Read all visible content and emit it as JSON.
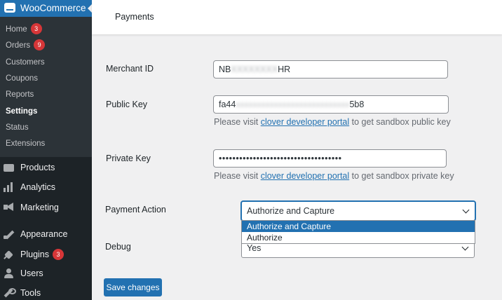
{
  "sidebar": {
    "brand": "WooCommerce",
    "submenu": [
      {
        "label": "Home",
        "badge": "3"
      },
      {
        "label": "Orders",
        "badge": "9"
      },
      {
        "label": "Customers"
      },
      {
        "label": "Coupons"
      },
      {
        "label": "Reports"
      },
      {
        "label": "Settings",
        "active": true
      },
      {
        "label": "Status"
      },
      {
        "label": "Extensions"
      }
    ],
    "menu": [
      {
        "label": "Products",
        "icon": "products-icon"
      },
      {
        "label": "Analytics",
        "icon": "analytics-icon"
      },
      {
        "label": "Marketing",
        "icon": "marketing-icon"
      },
      {
        "label": "Appearance",
        "icon": "appearance-icon"
      },
      {
        "label": "Plugins",
        "icon": "plugins-icon",
        "badge": "3"
      },
      {
        "label": "Users",
        "icon": "users-icon"
      },
      {
        "label": "Tools",
        "icon": "tools-icon"
      }
    ]
  },
  "header": {
    "title": "Payments"
  },
  "form": {
    "merchant_id": {
      "label": "Merchant ID",
      "value_prefix": "NB",
      "value_masked": "XXXXXXXX",
      "value_suffix": "HR"
    },
    "public_key": {
      "label": "Public Key",
      "value_prefix": "fa44",
      "value_masked": "XXXXXXXXXXXXXXXXXXXXXXXXXXX",
      "value_suffix": "5b8"
    },
    "public_note": {
      "before": "Please visit ",
      "link": "clover developer portal",
      "after": " to get sandbox public key"
    },
    "private_key": {
      "label": "Private Key",
      "value": "••••••••••••••••••••••••••••••••••••"
    },
    "private_note": {
      "before": "Please visit ",
      "link": "clover developer portal",
      "after": " to get sandbox private key"
    },
    "payment_action": {
      "label": "Payment Action",
      "selected": "Authorize and Capture",
      "options": [
        "Authorize and Capture",
        "Authorize"
      ]
    },
    "debug": {
      "label": "Debug",
      "selected": "Yes"
    },
    "save_label": "Save changes"
  },
  "colors": {
    "accent": "#2271b1",
    "sidebar": "#1d2327",
    "badge": "#d63638"
  }
}
